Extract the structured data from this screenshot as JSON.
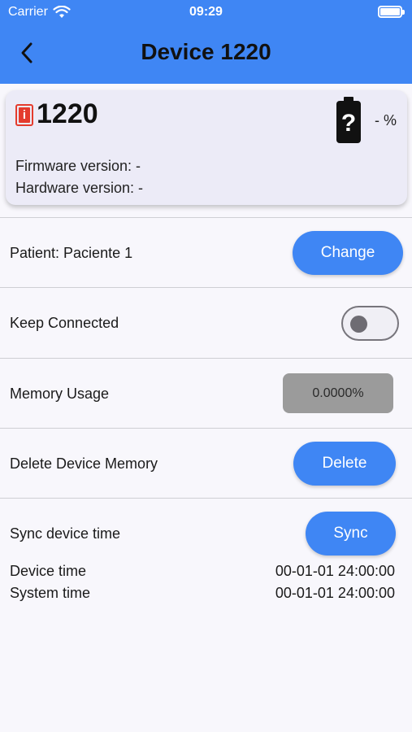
{
  "status_bar": {
    "carrier": "Carrier",
    "time": "09:29"
  },
  "header": {
    "title": "Device 1220",
    "back_icon": "chevron-left-icon",
    "background_color": "#3f86f4"
  },
  "device": {
    "info_icon": "i",
    "id": "1220",
    "battery_icon": "battery-unknown-icon",
    "battery_icon_glyph": "?",
    "battery_percent": "- %",
    "firmware_line": "Firmware version: -",
    "hardware_line": "Hardware version: -"
  },
  "patient": {
    "label": "Patient: Paciente 1",
    "button_label": "Change"
  },
  "keep_connected": {
    "label": "Keep Connected",
    "enabled": false
  },
  "memory": {
    "label": "Memory Usage",
    "value": "0.0000%"
  },
  "delete_memory": {
    "label": "Delete Device Memory",
    "button_label": "Delete"
  },
  "sync_time": {
    "label": "Sync device time",
    "button_label": "Sync",
    "device_time_label": "Device time",
    "device_time_value": "00-01-01 24:00:00",
    "system_time_label": "System time",
    "system_time_value": "00-01-01 24:00:00"
  },
  "colors": {
    "accent": "#3f86f4",
    "alert": "#e43b2d",
    "card_bg": "#ecebf7"
  }
}
